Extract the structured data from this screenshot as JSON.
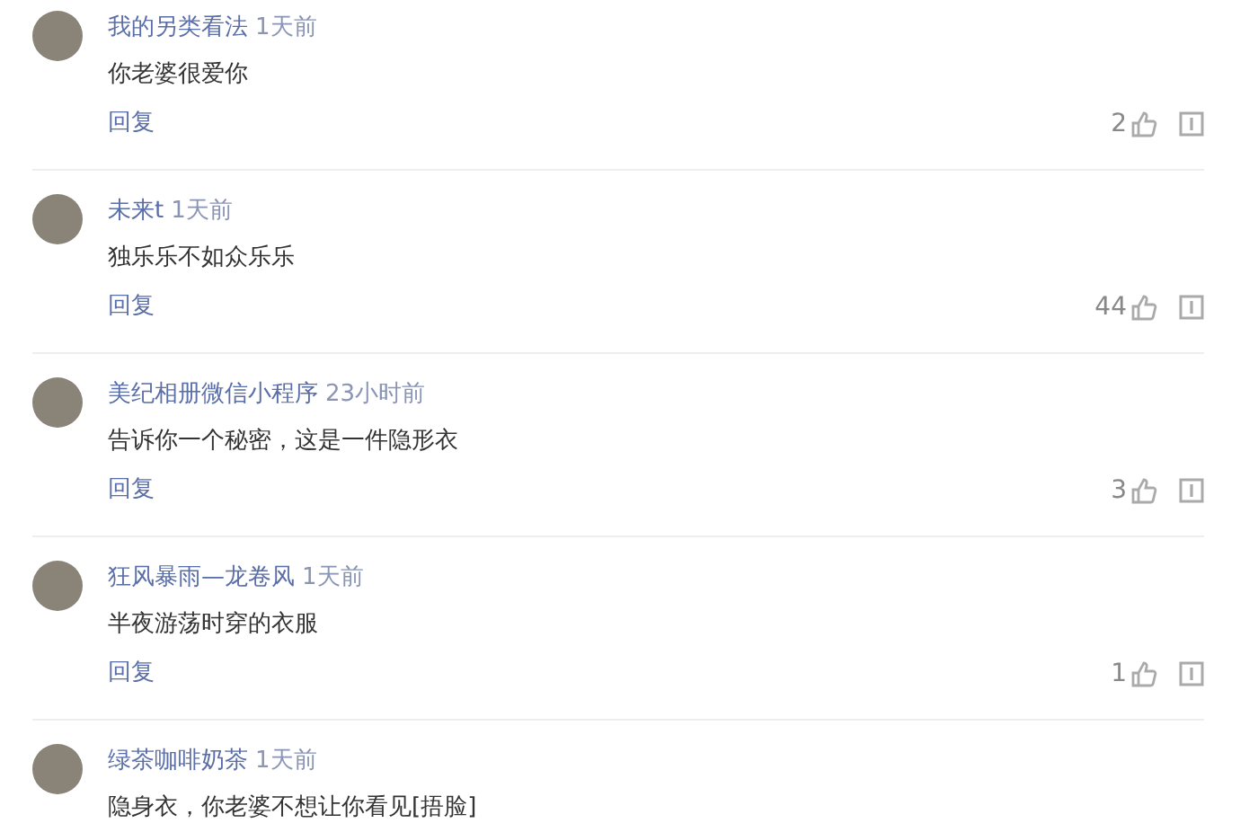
{
  "comments": [
    {
      "author": "我的另类看法",
      "time": "1天前",
      "text": "你老婆很爱你",
      "reply": "回复",
      "likes": "2"
    },
    {
      "author": "未来t",
      "time": "1天前",
      "text": "独乐乐不如众乐乐",
      "reply": "回复",
      "likes": "44"
    },
    {
      "author": "美纪相册微信小程序",
      "time": "23小时前",
      "text": "告诉你一个秘密，这是一件隐形衣",
      "reply": "回复",
      "likes": "3"
    },
    {
      "author": "狂风暴雨—龙卷风",
      "time": "1天前",
      "text": "半夜游荡时穿的衣服",
      "reply": "回复",
      "likes": "1"
    },
    {
      "author": "绿茶咖啡奶茶",
      "time": "1天前",
      "text": "隐身衣，你老婆不想让你看见[捂脸]"
    }
  ]
}
